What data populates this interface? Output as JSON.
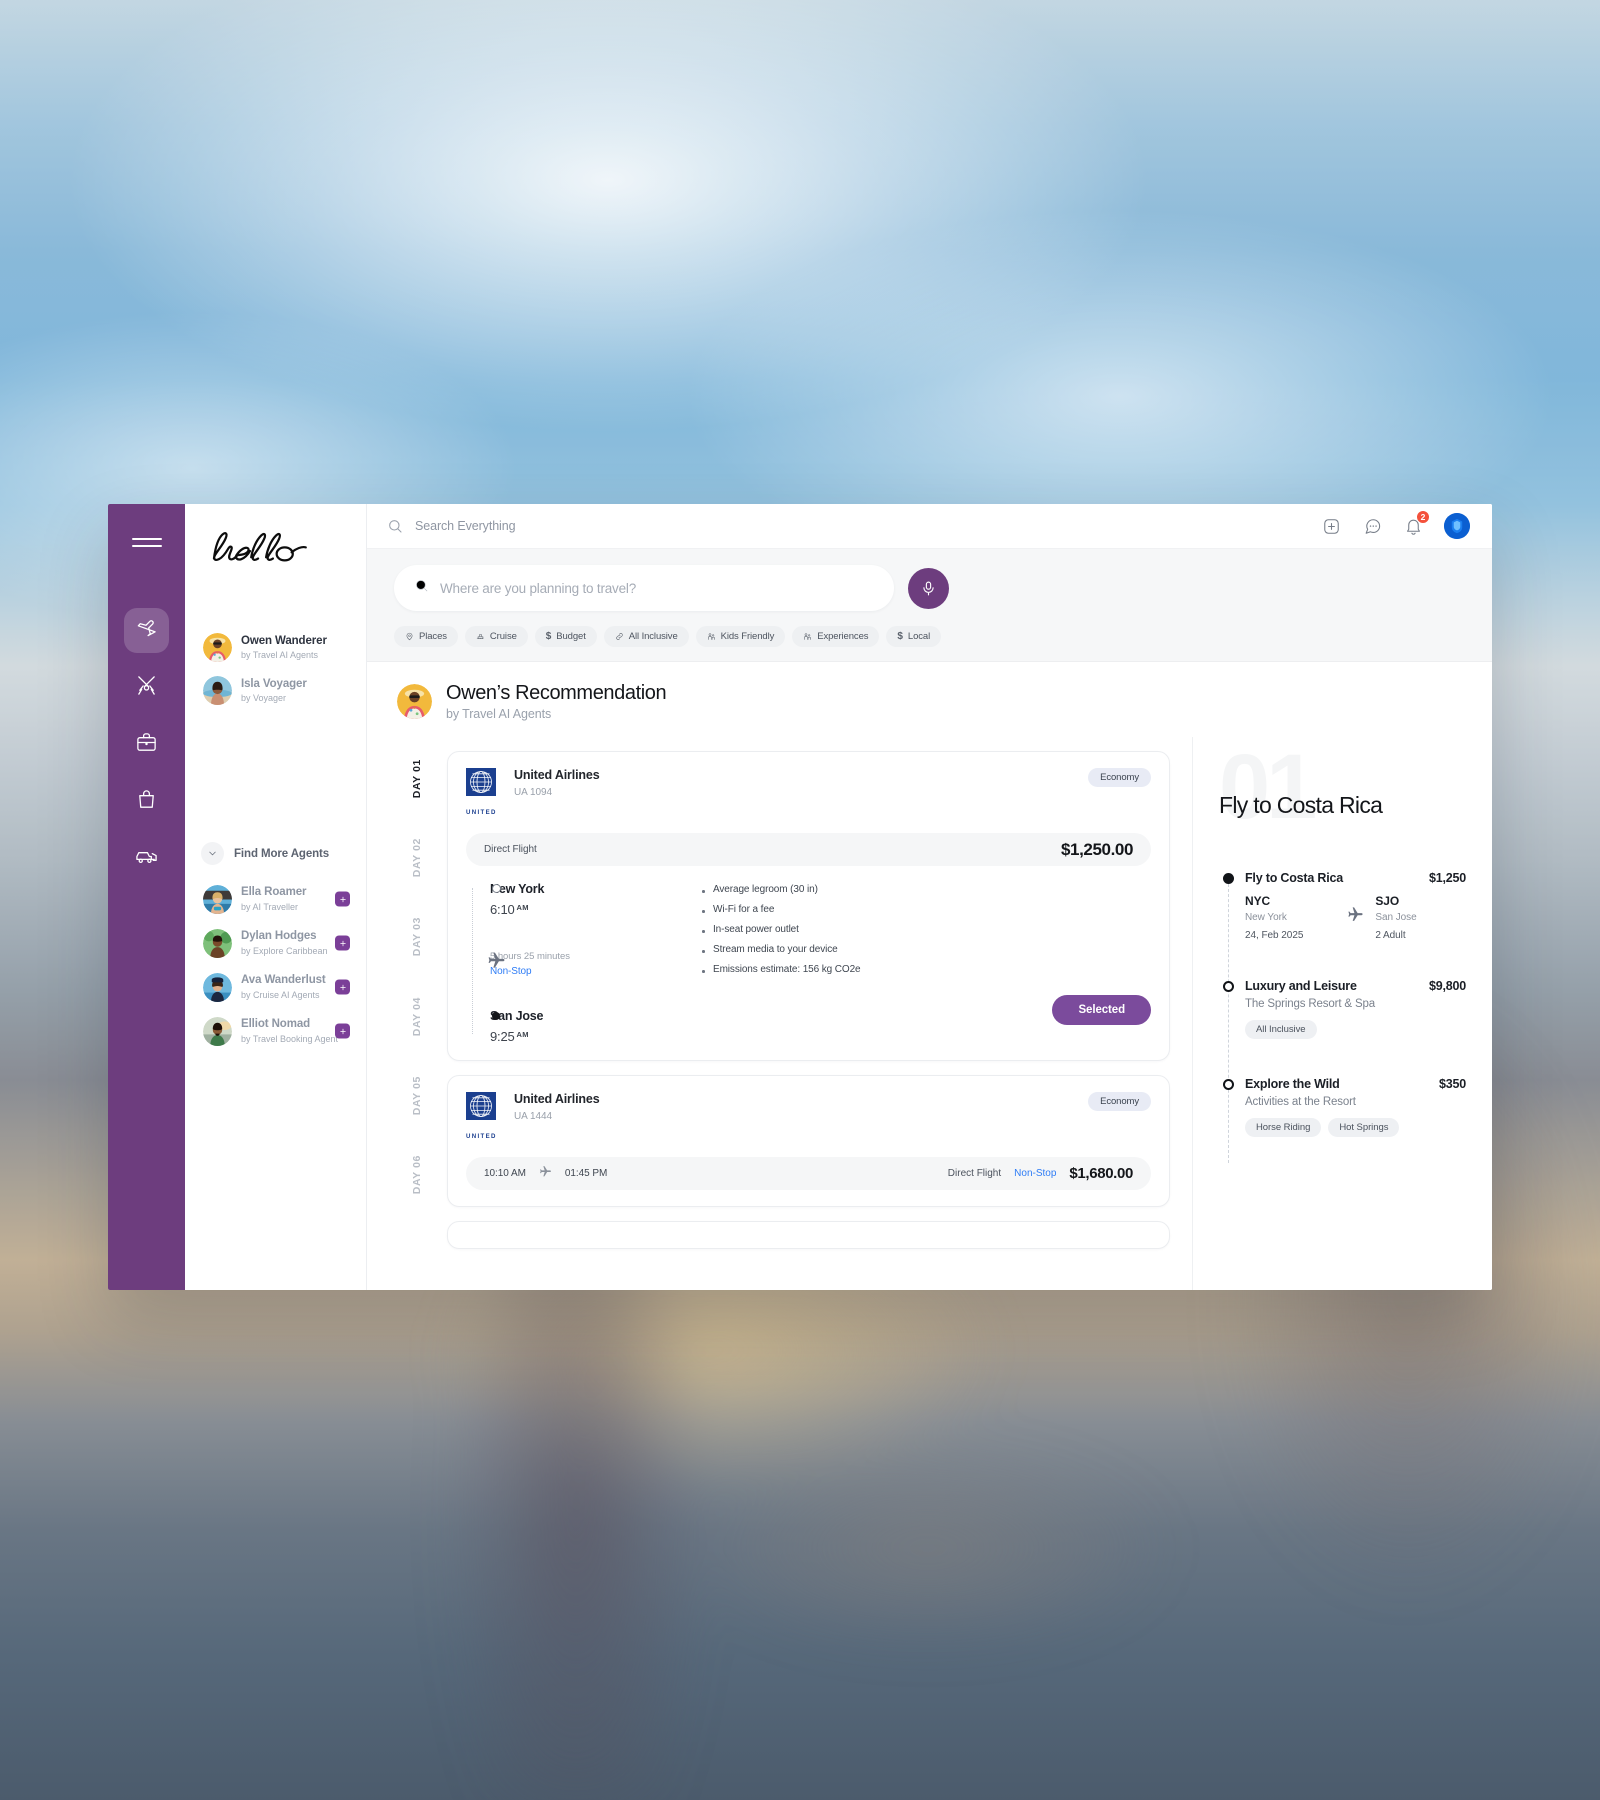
{
  "rail": {
    "menu_icon": "hamburger-icon",
    "items": [
      {
        "name": "flights",
        "icon": "airplane-icon",
        "active": true
      },
      {
        "name": "dining",
        "icon": "fork-knife-icon",
        "active": false
      },
      {
        "name": "business",
        "icon": "briefcase-icon",
        "active": false
      },
      {
        "name": "shopping",
        "icon": "shopping-bag-icon",
        "active": false
      },
      {
        "name": "car-rental",
        "icon": "car-icon",
        "active": false
      }
    ]
  },
  "sidebar": {
    "brand": "hello",
    "agents": [
      {
        "name": "Owen Wanderer",
        "sub": "by Travel AI Agents",
        "active": true
      },
      {
        "name": "Isla Voyager",
        "sub": "by Voyager",
        "active": false
      }
    ],
    "find_more_label": "Find More Agents",
    "more_agents": [
      {
        "name": "Ella Roamer",
        "sub": "by AI Traveller"
      },
      {
        "name": "Dylan Hodges",
        "sub": "by Explore Caribbean"
      },
      {
        "name": "Ava Wanderlust",
        "sub": "by Cruise AI Agents"
      },
      {
        "name": "Elliot Nomad",
        "sub": "by Travel Booking Agent"
      }
    ]
  },
  "topbar": {
    "search_placeholder": "Search Everything",
    "search_value": "",
    "add_icon": "plus-square-icon",
    "chat_icon": "chat-bubble-icon",
    "bell_icon": "bell-icon",
    "notification_count": "2",
    "avatar": "user-avatar"
  },
  "search": {
    "placeholder": "Where are you planning to travel?",
    "value": "",
    "mic_icon": "microphone-icon",
    "chips": [
      {
        "label": "Places",
        "icon": "map-pin-icon"
      },
      {
        "label": "Cruise",
        "icon": "ship-icon"
      },
      {
        "label": "Budget",
        "icon": "dollar-icon"
      },
      {
        "label": "All Inclusive",
        "icon": "link-icon"
      },
      {
        "label": "Kids Friendly",
        "icon": "family-icon"
      },
      {
        "label": "Experiences",
        "icon": "family-icon"
      },
      {
        "label": "Local",
        "icon": "dollar-icon"
      }
    ]
  },
  "recommendation": {
    "title": "Owen’s Recommendation",
    "subtitle": "by Travel AI Agents"
  },
  "days": [
    {
      "label": "DAY 01",
      "active": true
    },
    {
      "label": "DAY 02",
      "active": false
    },
    {
      "label": "DAY 03",
      "active": false
    },
    {
      "label": "DAY 04",
      "active": false
    },
    {
      "label": "DAY 05",
      "active": false
    },
    {
      "label": "DAY 06",
      "active": false
    }
  ],
  "flight1": {
    "airline": "United Airlines",
    "logo_word": "UNITED",
    "flight_no": "UA 1094",
    "cabin": "Economy",
    "direct_label": "Direct Flight",
    "price": "$1,250.00",
    "depart_city": "New York",
    "depart_time": "6:10",
    "depart_meridiem": "AM",
    "duration": "5 hours 25 minutes",
    "stops": "Non-Stop",
    "arrive_city": "San Jose",
    "arrive_time": "9:25",
    "arrive_meridiem": "AM",
    "amenities": [
      "Average legroom (30 in)",
      "Wi-Fi for a fee",
      "In-seat power outlet",
      "Stream media to your device",
      "Emissions estimate: 156 kg CO2e"
    ],
    "select_label": "Selected"
  },
  "flight2": {
    "airline": "United Airlines",
    "logo_word": "UNITED",
    "flight_no": "UA 1444",
    "cabin": "Economy",
    "depart_time": "10:10 AM",
    "arrive_time": "01:45 PM",
    "direct_label": "Direct Flight",
    "stops": "Non-Stop",
    "price": "$1,680.00"
  },
  "itinerary": {
    "big_number": "01",
    "title": "Fly to Costa Rica",
    "steps": [
      {
        "title": "Fly to Costa Rica",
        "price": "$1,250",
        "from_code": "NYC",
        "from_city": "New York",
        "to_code": "SJO",
        "to_city": "San Jose",
        "date": "24, Feb 2025",
        "pax": "2 Adult",
        "tags": []
      },
      {
        "title": "Luxury and Leisure",
        "price": "$9,800",
        "subtitle": "The Springs Resort & Spa",
        "tags": [
          "All Inclusive"
        ]
      },
      {
        "title": "Explore the Wild",
        "price": "$350",
        "subtitle": "Activities at the Resort",
        "tags": [
          "Horse Riding",
          "Hot Springs"
        ]
      }
    ]
  },
  "colors": {
    "brand_purple": "#6d3d7e",
    "accent_purple": "#7b4b9c",
    "link_blue": "#2f7df6",
    "badge_red": "#f4513b",
    "united_blue": "#1b3f8f"
  }
}
